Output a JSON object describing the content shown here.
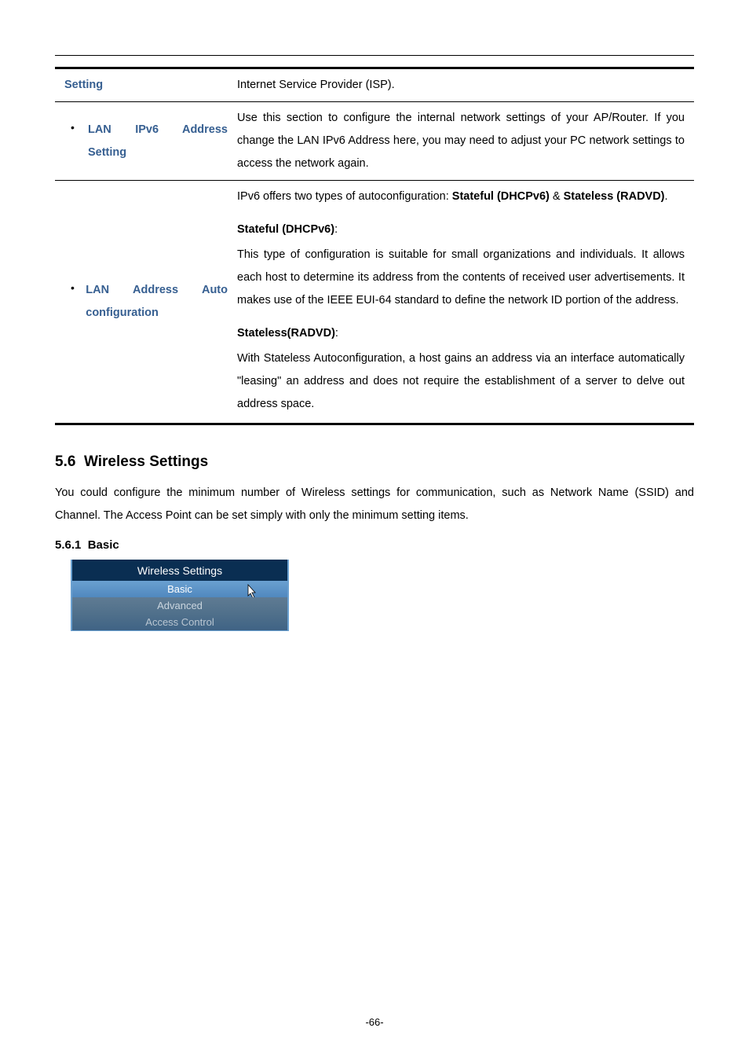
{
  "table": {
    "rows": [
      {
        "label": "Setting",
        "desc": "Internet Service Provider (ISP)."
      },
      {
        "label": "LAN IPv6 Address Setting",
        "desc": "Use this section to configure the internal network settings of your AP/Router. If you change the LAN IPv6 Address here, you may need to adjust your PC network settings to access the network again."
      },
      {
        "label": "LAN Address Auto configuration",
        "intro_pre": "IPv6 offers two types of autoconfiguration: ",
        "intro_bold": "Stateful (DHCPv6)",
        "intro_amp": " & ",
        "intro_bold2": "Stateless (RADVD)",
        "intro_post": ".",
        "sub1_title": "Stateful (DHCPv6)",
        "sub1_body": "This type of configuration is suitable for small organizations and individuals. It allows each host to determine its address from the contents of received user advertisements. It makes use of the IEEE EUI-64 standard to define the network ID portion of the address.",
        "sub2_title": "Stateless(RADVD)",
        "sub2_body": "With Stateless Autoconfiguration, a host gains an address via an interface automatically \"leasing\" an address and does not require the establishment of a server to delve out address space."
      }
    ]
  },
  "section": {
    "number": "5.6",
    "title": "Wireless Settings",
    "desc": "You could configure the minimum number of Wireless settings for communication, such as Network Name (SSID) and Channel. The Access Point can be set simply with only the minimum setting items."
  },
  "subsection": {
    "number": "5.6.1",
    "title": "Basic"
  },
  "menu": {
    "header": "Wireless Settings",
    "items": [
      {
        "label": "Basic",
        "state": "selected"
      },
      {
        "label": "Advanced",
        "state": "inactive1"
      },
      {
        "label": "Access Control",
        "state": "inactive2"
      }
    ]
  },
  "page_number": "-66-"
}
